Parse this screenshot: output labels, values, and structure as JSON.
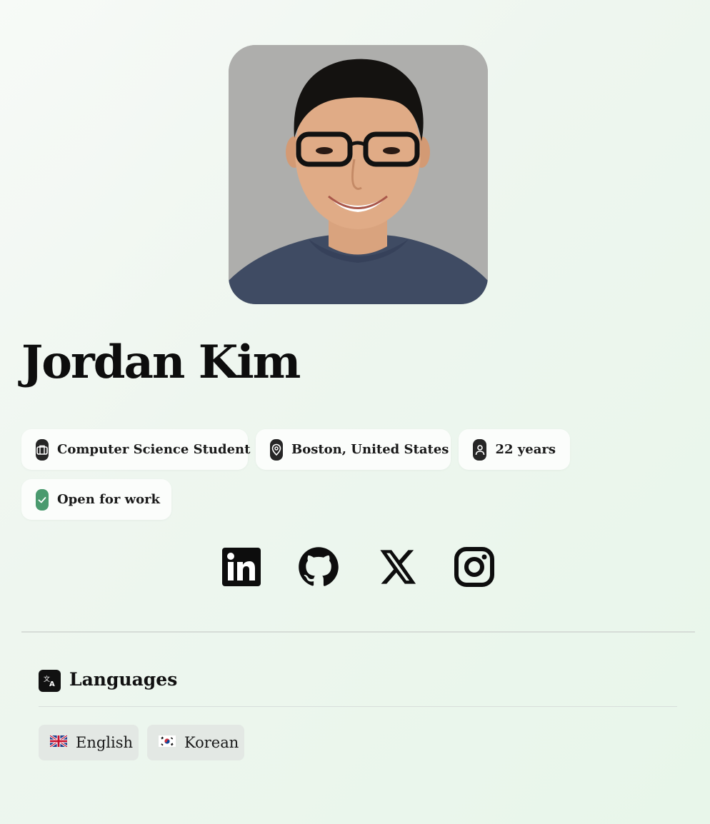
{
  "profile": {
    "name": "Jordan Kim",
    "photo_alt": "Portrait of Jordan Kim"
  },
  "chips": {
    "occupation": "Computer Science Student",
    "location": "Boston, United States",
    "age": "22 years",
    "status": "Open for work"
  },
  "social": [
    {
      "name": "linkedin-icon"
    },
    {
      "name": "github-icon"
    },
    {
      "name": "x-icon"
    },
    {
      "name": "instagram-icon"
    }
  ],
  "languages": {
    "title": "Languages",
    "items": [
      {
        "label": "English",
        "flag": "uk-flag-icon"
      },
      {
        "label": "Korean",
        "flag": "kr-flag-icon"
      }
    ]
  },
  "colors": {
    "status_green": "#4a9a6e",
    "icon_dark": "#262626"
  }
}
